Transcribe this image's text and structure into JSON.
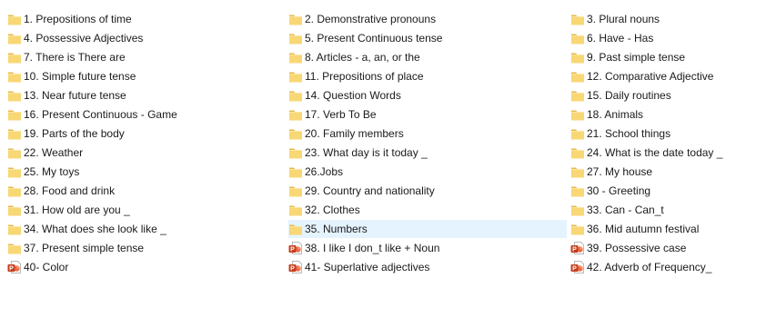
{
  "items": [
    {
      "label": "1. Prepositions of time",
      "icon": "folder-icon"
    },
    {
      "label": "2. Demonstrative pronouns",
      "icon": "folder-icon"
    },
    {
      "label": "3. Plural nouns",
      "icon": "folder-icon"
    },
    {
      "label": "4. Possessive Adjectives",
      "icon": "folder-icon"
    },
    {
      "label": "5. Present Continuous tense",
      "icon": "folder-icon"
    },
    {
      "label": "6. Have - Has",
      "icon": "folder-icon"
    },
    {
      "label": "7. There is There are",
      "icon": "folder-icon"
    },
    {
      "label": "8. Articles - a, an, or the",
      "icon": "folder-icon"
    },
    {
      "label": "9. Past simple tense",
      "icon": "folder-icon"
    },
    {
      "label": "10. Simple future tense",
      "icon": "folder-icon"
    },
    {
      "label": "11. Prepositions of place",
      "icon": "folder-icon"
    },
    {
      "label": "12. Comparative Adjective",
      "icon": "folder-icon"
    },
    {
      "label": "13. Near future tense",
      "icon": "folder-icon"
    },
    {
      "label": "14. Question Words",
      "icon": "folder-icon"
    },
    {
      "label": "15. Daily routines",
      "icon": "folder-icon"
    },
    {
      "label": "16. Present Continuous - Game",
      "icon": "folder-icon"
    },
    {
      "label": "17. Verb To Be",
      "icon": "folder-icon"
    },
    {
      "label": "18. Animals",
      "icon": "folder-icon"
    },
    {
      "label": "19. Parts of the body",
      "icon": "folder-icon"
    },
    {
      "label": "20. Family members",
      "icon": "folder-icon"
    },
    {
      "label": "21. School things",
      "icon": "folder-icon"
    },
    {
      "label": "22. Weather",
      "icon": "folder-icon"
    },
    {
      "label": "23. What day is it today _",
      "icon": "folder-icon"
    },
    {
      "label": "24. What is the date today _",
      "icon": "folder-icon"
    },
    {
      "label": "25. My toys",
      "icon": "folder-icon"
    },
    {
      "label": "26.Jobs",
      "icon": "folder-icon"
    },
    {
      "label": "27. My house",
      "icon": "folder-icon"
    },
    {
      "label": "28. Food and drink",
      "icon": "folder-icon"
    },
    {
      "label": "29. Country and nationality",
      "icon": "folder-icon"
    },
    {
      "label": "30 - Greeting",
      "icon": "folder-icon"
    },
    {
      "label": "31. How old are you _",
      "icon": "folder-icon"
    },
    {
      "label": "32. Clothes",
      "icon": "folder-icon"
    },
    {
      "label": "33. Can - Can_t",
      "icon": "folder-icon"
    },
    {
      "label": "34. What does she look like _",
      "icon": "folder-icon"
    },
    {
      "label": "35. Numbers",
      "icon": "folder-icon",
      "selected": true
    },
    {
      "label": "36. Mid autumn festival",
      "icon": "folder-icon"
    },
    {
      "label": "37. Present simple tense",
      "icon": "folder-icon"
    },
    {
      "label": "38. I like I don_t like + Noun",
      "icon": "powerpoint-file-icon"
    },
    {
      "label": "39. Possessive case",
      "icon": "powerpoint-file-icon"
    },
    {
      "label": "40- Color",
      "icon": "powerpoint-file-icon"
    },
    {
      "label": "41- Superlative adjectives",
      "icon": "powerpoint-file-icon"
    },
    {
      "label": "42. Adverb of Frequency_",
      "icon": "powerpoint-file-icon"
    }
  ],
  "colors": {
    "selection": "#e5f3ff",
    "folder_fill": "#f8d775",
    "folder_back": "#e8b94a",
    "ppt_red": "#c43e1c"
  }
}
